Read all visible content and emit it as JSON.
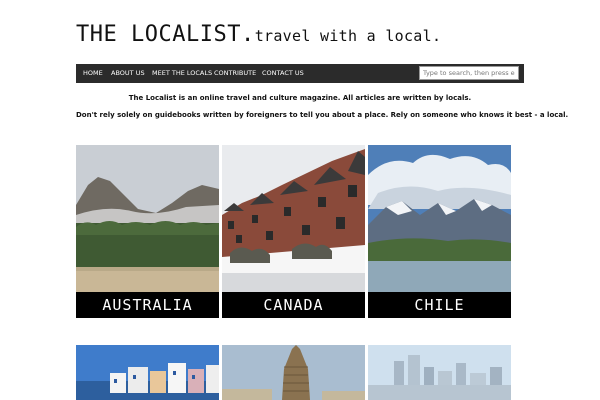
{
  "header": {
    "brand": "THE LOCALIST.",
    "tagline": "travel with a local."
  },
  "nav": {
    "items": [
      {
        "label": "HOME"
      },
      {
        "label": "ABOUT US"
      },
      {
        "label": "MEET THE LOCALS"
      },
      {
        "label": "CONTRIBUTE"
      },
      {
        "label": "CONTACT US"
      }
    ],
    "search_placeholder": "Type to search, then press enter"
  },
  "intro": {
    "line1": "The Localist is an online travel and culture magazine. All articles are written by locals.",
    "line2": "Don't rely solely on guidebooks written by foreigners to tell you about a place. Rely on someone who knows it best - a local."
  },
  "destinations": [
    {
      "label": "AUSTRALIA"
    },
    {
      "label": "CANADA"
    },
    {
      "label": "CHILE"
    }
  ],
  "colors": {
    "nav_bg": "#2b2b2b",
    "label_bg": "#000000"
  }
}
